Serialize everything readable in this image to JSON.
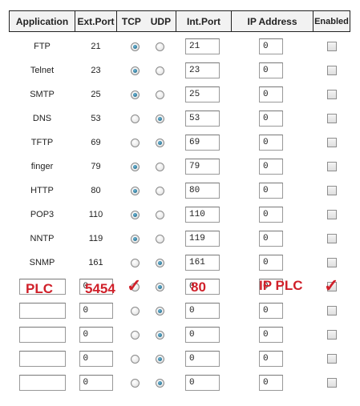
{
  "headers": {
    "application": "Application",
    "ext_port": "Ext.Port",
    "tcp": "TCP",
    "udp": "UDP",
    "int_port": "Int.Port",
    "ip_address": "IP Address",
    "enabled": "Enabled"
  },
  "rows": [
    {
      "application": "FTP",
      "ext_port": "21",
      "protocol": "TCP",
      "int_port": "21",
      "ip": "0",
      "enabled": false
    },
    {
      "application": "Telnet",
      "ext_port": "23",
      "protocol": "TCP",
      "int_port": "23",
      "ip": "0",
      "enabled": false
    },
    {
      "application": "SMTP",
      "ext_port": "25",
      "protocol": "TCP",
      "int_port": "25",
      "ip": "0",
      "enabled": false
    },
    {
      "application": "DNS",
      "ext_port": "53",
      "protocol": "UDP",
      "int_port": "53",
      "ip": "0",
      "enabled": false
    },
    {
      "application": "TFTP",
      "ext_port": "69",
      "protocol": "UDP",
      "int_port": "69",
      "ip": "0",
      "enabled": false
    },
    {
      "application": "finger",
      "ext_port": "79",
      "protocol": "TCP",
      "int_port": "79",
      "ip": "0",
      "enabled": false
    },
    {
      "application": "HTTP",
      "ext_port": "80",
      "protocol": "TCP",
      "int_port": "80",
      "ip": "0",
      "enabled": false
    },
    {
      "application": "POP3",
      "ext_port": "110",
      "protocol": "TCP",
      "int_port": "110",
      "ip": "0",
      "enabled": false
    },
    {
      "application": "NNTP",
      "ext_port": "119",
      "protocol": "TCP",
      "int_port": "119",
      "ip": "0",
      "enabled": false
    },
    {
      "application": "SNMP",
      "ext_port": "161",
      "protocol": "UDP",
      "int_port": "161",
      "ip": "0",
      "enabled": false
    }
  ],
  "custom_rows": [
    {
      "application": "",
      "ext_port": "0",
      "protocol": "UDP",
      "int_port": "0",
      "ip": "0",
      "enabled": false
    },
    {
      "application": "",
      "ext_port": "0",
      "protocol": "UDP",
      "int_port": "0",
      "ip": "0",
      "enabled": false
    },
    {
      "application": "",
      "ext_port": "0",
      "protocol": "UDP",
      "int_port": "0",
      "ip": "0",
      "enabled": false
    },
    {
      "application": "",
      "ext_port": "0",
      "protocol": "UDP",
      "int_port": "0",
      "ip": "0",
      "enabled": false
    },
    {
      "application": "",
      "ext_port": "0",
      "protocol": "UDP",
      "int_port": "0",
      "ip": "0",
      "enabled": false
    }
  ],
  "annotations": {
    "application": "PLC",
    "ext_port": "5454",
    "tcp_check": "✓",
    "int_port": "80",
    "ip": "IP PLC",
    "enabled_check": "✓"
  },
  "colors": {
    "annotation": "#d0202a",
    "radio_selected": "#0d5a7a"
  }
}
